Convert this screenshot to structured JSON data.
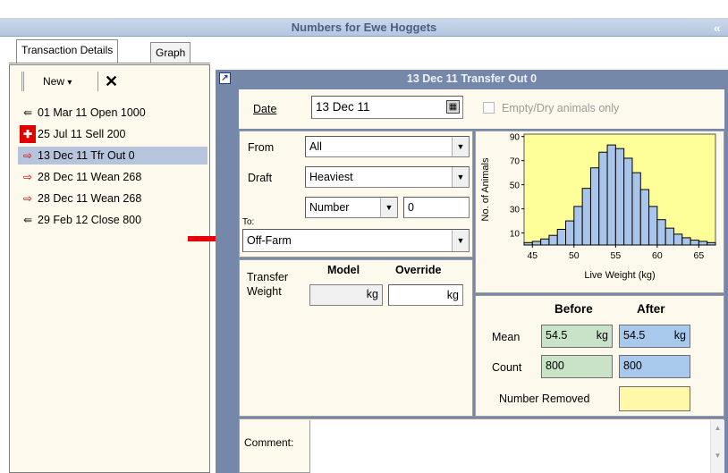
{
  "window": {
    "title": "Numbers for Ewe Hoggets",
    "collapse_glyph": "«"
  },
  "tabs": [
    {
      "label": "Transaction Details",
      "active": true
    },
    {
      "label": "Graph",
      "active": false
    }
  ],
  "toolbar": {
    "new_label": "New",
    "new_arrow": "▾",
    "delete_glyph": "✕"
  },
  "transactions": [
    {
      "label": "01 Mar 11 Open 1000",
      "icon": "open-icon",
      "selected": false
    },
    {
      "label": "25 Jul 11 Sell 200",
      "icon": "sell-icon",
      "selected": false
    },
    {
      "label": "13 Dec 11 Tfr Out 0",
      "icon": "transfer-icon",
      "selected": true
    },
    {
      "label": "28 Dec 11 Wean 268",
      "icon": "transfer-icon",
      "selected": false
    },
    {
      "label": "28 Dec 11 Wean 268",
      "icon": "transfer-icon",
      "selected": false
    },
    {
      "label": "29 Feb 12 Close 800",
      "icon": "close-icon",
      "selected": false
    }
  ],
  "detail": {
    "title": "13 Dec 11  Transfer Out 0",
    "date_label": "Date",
    "date_value": "13 Dec 11",
    "empty_dry_label": "Empty/Dry animals only",
    "from_label": "From",
    "from_value": "All",
    "draft_label": "Draft",
    "draft_value": "Heaviest",
    "number_mode": "Number",
    "number_value": "0",
    "to_label": "To:",
    "to_value": "Off-Farm",
    "transfer_label_1": "Transfer",
    "transfer_label_2": "Weight",
    "model_header": "Model",
    "override_header": "Override",
    "unit_kg": "kg",
    "comment_label": "Comment:"
  },
  "stats": {
    "before_header": "Before",
    "after_header": "After",
    "mean_label": "Mean",
    "count_label": "Count",
    "removed_label": "Number Removed",
    "mean_before": "54.5",
    "mean_after": "54.5",
    "mean_unit": "kg",
    "count_before": "800",
    "count_after": "800"
  },
  "chart_data": {
    "type": "bar",
    "title": "",
    "xlabel": "Live Weight (kg)",
    "ylabel": "No. of Animals",
    "x_ticks": [
      "45",
      "50",
      "55",
      "60",
      "65"
    ],
    "y_ticks": [
      "10",
      "30",
      "50",
      "70",
      "90"
    ],
    "xlim": [
      44,
      67
    ],
    "ylim": [
      0,
      92
    ],
    "bin_width": 1,
    "x": [
      44,
      45,
      46,
      47,
      48,
      49,
      50,
      51,
      52,
      53,
      54,
      55,
      56,
      57,
      58,
      59,
      60,
      61,
      62,
      63,
      64,
      65,
      66
    ],
    "values": [
      2,
      3,
      5,
      8,
      13,
      20,
      32,
      47,
      64,
      77,
      83,
      80,
      72,
      60,
      46,
      32,
      21,
      14,
      9,
      6,
      4,
      3,
      2
    ],
    "colors": {
      "bar": "#a9c6ea",
      "plot_bg": "#ffff99"
    }
  },
  "annotation": {
    "arrow_color": "#e8000a"
  }
}
